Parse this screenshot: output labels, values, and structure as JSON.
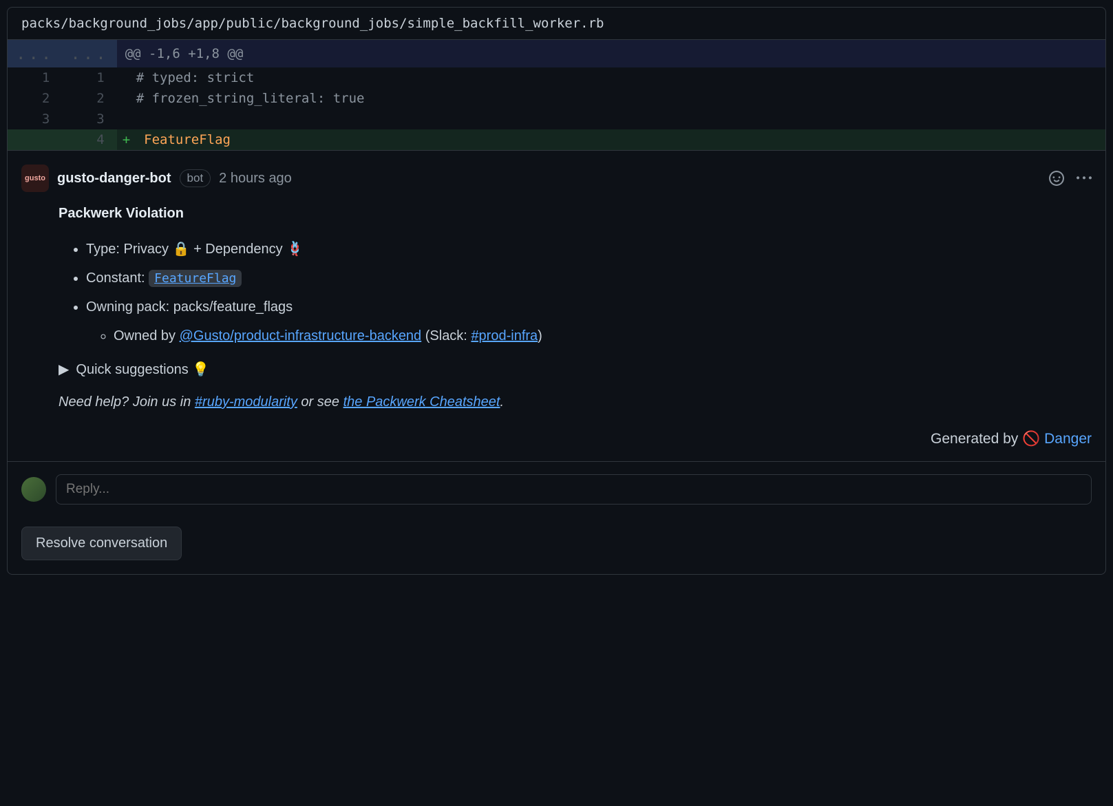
{
  "file": {
    "path": "packs/background_jobs/app/public/background_jobs/simple_backfill_worker.rb"
  },
  "diff": {
    "hunk_header": "@@ -1,6 +1,8 @@",
    "lines": [
      {
        "old": "1",
        "new": "1",
        "content": "# typed: strict",
        "type": "context"
      },
      {
        "old": "2",
        "new": "2",
        "content": "# frozen_string_literal: true",
        "type": "context"
      },
      {
        "old": "3",
        "new": "3",
        "content": "",
        "type": "context"
      },
      {
        "old": "",
        "new": "4",
        "content": "FeatureFlag",
        "type": "addition"
      }
    ]
  },
  "comment": {
    "avatar_text": "gusto",
    "author": "gusto-danger-bot",
    "bot_label": "bot",
    "timestamp": "2 hours ago",
    "title": "Packwerk Violation",
    "type_prefix": "Type: ",
    "type_value": "Privacy 🔒 + Dependency 🪢",
    "constant_prefix": "Constant: ",
    "constant_value": "FeatureFlag",
    "owning_pack_prefix": "Owning pack: ",
    "owning_pack_value": "packs/feature_flags",
    "owned_by_prefix": "Owned by ",
    "owned_by_team": "@Gusto/product-infrastructure-backend",
    "slack_prefix": " (Slack: ",
    "slack_channel": "#prod-infra",
    "slack_suffix": ")",
    "quick_suggestions": "Quick suggestions 💡",
    "help_prefix": "Need help? Join us in ",
    "help_link1": "#ruby-modularity",
    "help_mid": " or see ",
    "help_link2": "the Packwerk Cheatsheet",
    "help_suffix": ".",
    "generated_prefix": "Generated by 🚫 ",
    "generated_link": "Danger"
  },
  "reply": {
    "placeholder": "Reply..."
  },
  "resolve": {
    "label": "Resolve conversation"
  }
}
